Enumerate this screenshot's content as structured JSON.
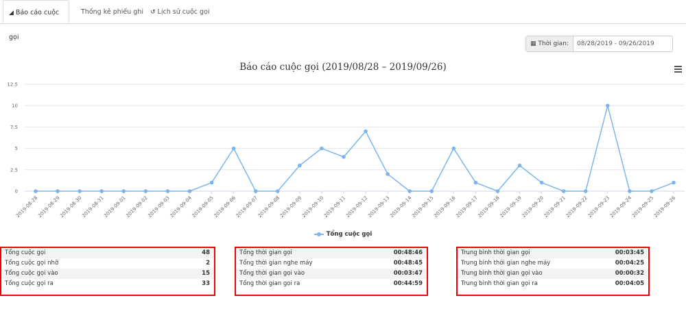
{
  "tabs": [
    {
      "label": "Báo cáo cuộc gọi",
      "icon": "area-chart-icon",
      "active": true
    },
    {
      "label": "Thống kê phiếu ghi",
      "icon": "",
      "active": false
    },
    {
      "label": "Lịch sử cuộc gọi",
      "icon": "history-icon",
      "active": false
    }
  ],
  "filter": {
    "label": "Thời gian:",
    "value": "08/28/2019 - 09/26/2019",
    "icon": "calendar-icon"
  },
  "chart_data": {
    "type": "line",
    "title": "Báo cáo cuộc gọi (2019/08/28 – 2019/09/26)",
    "categories": [
      "2019-08-28",
      "2019-08-29",
      "2019-08-30",
      "2019-08-31",
      "2019-09-01",
      "2019-09-02",
      "2019-09-03",
      "2019-09-04",
      "2019-09-05",
      "2019-09-06",
      "2019-09-07",
      "2019-09-08",
      "2019-09-09",
      "2019-09-10",
      "2019-09-11",
      "2019-09-12",
      "2019-09-13",
      "2019-09-14",
      "2019-09-15",
      "2019-09-16",
      "2019-09-17",
      "2019-09-18",
      "2019-09-19",
      "2019-09-20",
      "2019-09-21",
      "2019-09-22",
      "2019-09-23",
      "2019-09-24",
      "2019-09-25",
      "2019-09-26"
    ],
    "series": [
      {
        "name": "Tổng cuộc gọi",
        "color": "#7cb5ec",
        "values": [
          0,
          0,
          0,
          0,
          0,
          0,
          0,
          0,
          1,
          5,
          0,
          0,
          3,
          5,
          4,
          7,
          2,
          0,
          0,
          5,
          1,
          0,
          3,
          1,
          0,
          0,
          10,
          0,
          0,
          1
        ]
      }
    ],
    "yticks": [
      "0",
      "2.5",
      "5",
      "7.5",
      "10",
      "12.5"
    ],
    "ylim": [
      0,
      12.5
    ],
    "legend_position": "bottom-center"
  },
  "stats": [
    {
      "rows": [
        {
          "label": "Tổng cuộc gọi",
          "value": "48"
        },
        {
          "label": "Tổng cuộc gọi nhỡ",
          "value": "2"
        },
        {
          "label": "Tổng cuộc gọi vào",
          "value": "15"
        },
        {
          "label": "Tổng cuộc gọi ra",
          "value": "33"
        }
      ]
    },
    {
      "rows": [
        {
          "label": "Tổng thời gian gọi",
          "value": "00:48:46"
        },
        {
          "label": "Tổng thời gian nghe máy",
          "value": "00:48:45"
        },
        {
          "label": "Tổng thời gian gọi vào",
          "value": "00:03:47"
        },
        {
          "label": "Tổng thời gian gọi ra",
          "value": "00:44:59"
        }
      ]
    },
    {
      "rows": [
        {
          "label": "Trung bình thời gian gọi",
          "value": "00:03:45"
        },
        {
          "label": "Trung bình thời gian nghe máy",
          "value": "00:04:25"
        },
        {
          "label": "Trung bình thời gian gọi vào",
          "value": "00:00:32"
        },
        {
          "label": "Trung bình thời gian gọi ra",
          "value": "00:04:05"
        }
      ]
    }
  ]
}
